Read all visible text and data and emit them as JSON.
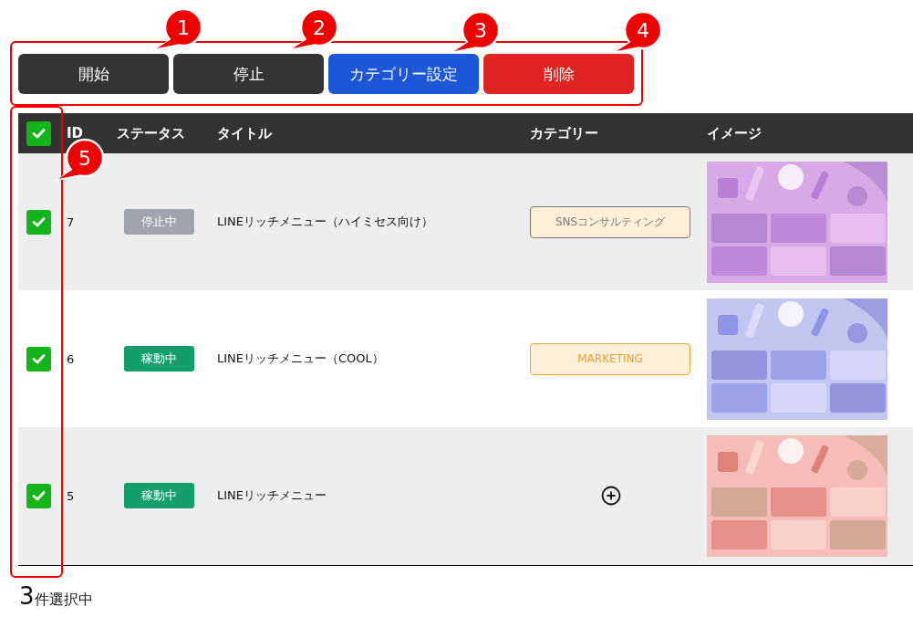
{
  "toolbar": {
    "buttons": [
      {
        "label": "開始",
        "kind": "dark"
      },
      {
        "label": "停止",
        "kind": "dark"
      },
      {
        "label": "カテゴリー設定",
        "kind": "primary"
      },
      {
        "label": "削除",
        "kind": "danger"
      }
    ]
  },
  "table": {
    "select_all": {
      "checked": true
    },
    "columns": [
      "ID",
      "ステータス",
      "タイトル",
      "カテゴリー",
      "イメージ"
    ],
    "rows": [
      {
        "checked": true,
        "id": "7",
        "status": {
          "label": "停止中",
          "kind": "stopped"
        },
        "title": "LINEリッチメニュー（ハイミセス向け）",
        "category": {
          "kind": "tag",
          "label": "SNSコンサルティング",
          "color": "#7a7a7a"
        }
      },
      {
        "checked": true,
        "id": "6",
        "status": {
          "label": "稼動中",
          "kind": "active"
        },
        "title": "LINEリッチメニュー（COOL）",
        "category": {
          "kind": "tag",
          "label": "MARKETING",
          "color": "#f0a235"
        }
      },
      {
        "checked": true,
        "id": "5",
        "status": {
          "label": "稼動中",
          "kind": "active"
        },
        "title": "LINEリッチメニュー",
        "category": {
          "kind": "add"
        }
      }
    ]
  },
  "footer": {
    "selection_count": "3",
    "selection_label": "件選択中"
  },
  "annotations": {
    "callouts": [
      "1",
      "2",
      "3",
      "4",
      "5"
    ]
  }
}
